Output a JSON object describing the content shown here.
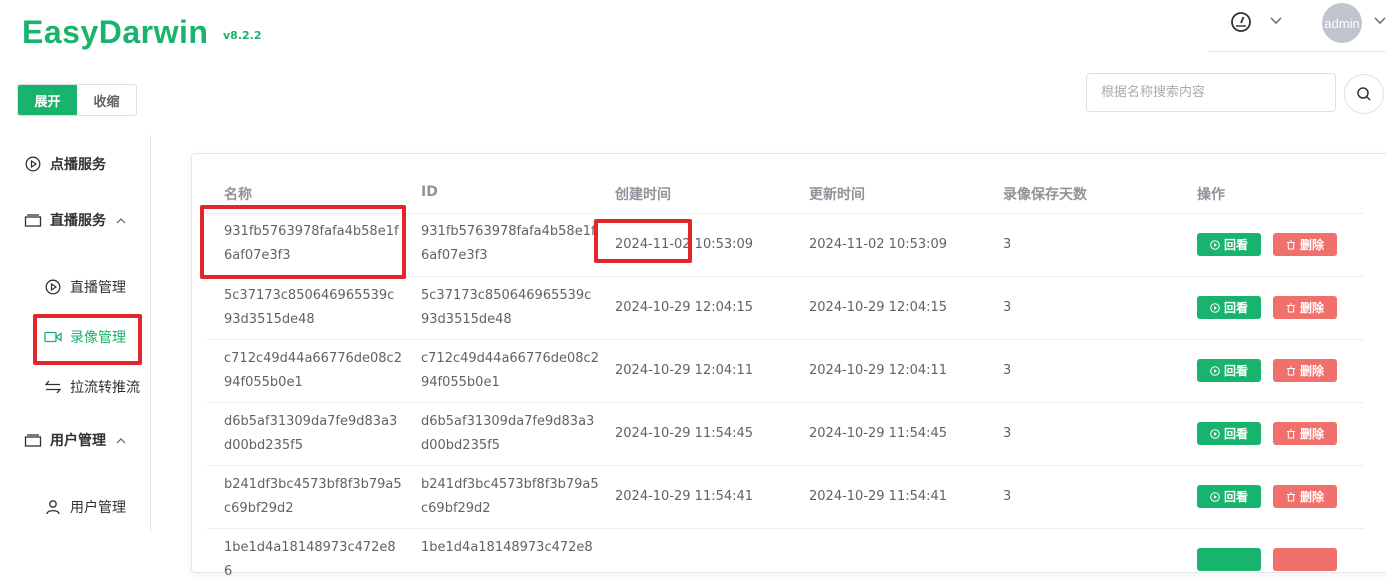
{
  "brand": {
    "name": "EasyDarwin",
    "version": "v8.2.2"
  },
  "header": {
    "user": "admin"
  },
  "toggle": {
    "expand": "展开",
    "collapse": "收缩"
  },
  "search": {
    "placeholder": "根据名称搜索内容"
  },
  "sidebar": {
    "vod": "点播服务",
    "live": "直播服务",
    "live_manage": "直播管理",
    "record_manage": "录像管理",
    "pull_push": "拉流转推流",
    "users": "用户管理",
    "user_manage": "用户管理"
  },
  "table": {
    "columns": [
      "名称",
      "ID",
      "创建时间",
      "更新时间",
      "录像保存天数",
      "操作"
    ],
    "actions": {
      "play": "回看",
      "delete": "删除"
    },
    "rows": [
      {
        "name": "931fb5763978fafa4b58e1f6af07e3f3",
        "id": "931fb5763978fafa4b58e1f6af07e3f3",
        "created": "2024-11-02 10:53:09",
        "updated": "2024-11-02 10:53:09",
        "days": "3"
      },
      {
        "name": "5c37173c850646965539c93d3515de48",
        "id": "5c37173c850646965539c93d3515de48",
        "created": "2024-10-29 12:04:15",
        "updated": "2024-10-29 12:04:15",
        "days": "3"
      },
      {
        "name": "c712c49d44a66776de08c294f055b0e1",
        "id": "c712c49d44a66776de08c294f055b0e1",
        "created": "2024-10-29 12:04:11",
        "updated": "2024-10-29 12:04:11",
        "days": "3"
      },
      {
        "name": "d6b5af31309da7fe9d83a3d00bd235f5",
        "id": "d6b5af31309da7fe9d83a3d00bd235f5",
        "created": "2024-10-29 11:54:45",
        "updated": "2024-10-29 11:54:45",
        "days": "3"
      },
      {
        "name": "b241df3bc4573bf8f3b79a5c69bf29d2",
        "id": "b241df3bc4573bf8f3b79a5c69bf29d2",
        "created": "2024-10-29 11:54:41",
        "updated": "2024-10-29 11:54:41",
        "days": "3"
      },
      {
        "name": "1be1d4a18148973c472e86",
        "id": "1be1d4a18148973c472e8",
        "created": "",
        "updated": "",
        "days": ""
      }
    ]
  },
  "colors": {
    "accent": "#18b36c",
    "danger": "#f0706c",
    "highlight": "#e3262c"
  }
}
